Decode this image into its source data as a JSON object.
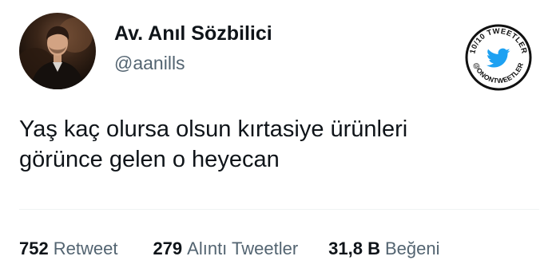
{
  "author": {
    "display_name": "Av. Anıl Sözbilici",
    "handle": "@aanills"
  },
  "badge": {
    "top_text": "10/10 TWEETLER",
    "bottom_text": "@ONONTWEETLER",
    "icon": "twitter-bird-icon",
    "accent_color": "#1da1f2"
  },
  "tweet": {
    "lines": [
      "Yaş kaç olursa olsun kırtasiye ürünleri",
      "görünce gelen o heyecan"
    ]
  },
  "stats": {
    "retweets": {
      "count": "752",
      "label": "Retweet"
    },
    "quotes": {
      "count": "279",
      "label": "Alıntı Tweetler"
    },
    "likes": {
      "count": "31,8 B",
      "label": "Beğeni"
    }
  },
  "colors": {
    "text_primary": "#0f1419",
    "text_secondary": "#536471",
    "divider": "#eff3f4"
  }
}
